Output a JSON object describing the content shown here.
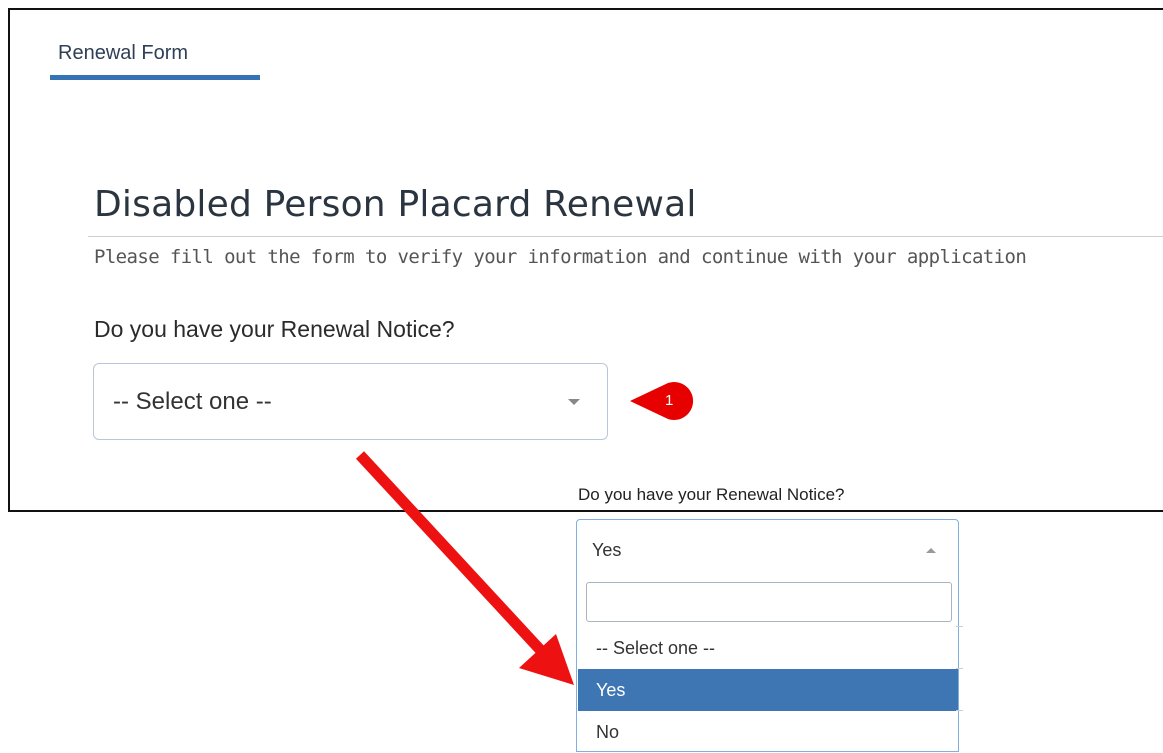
{
  "tab": {
    "label": "Renewal Form"
  },
  "page": {
    "heading": "Disabled Person Placard Renewal",
    "subtitle": "Please fill out the form to verify your information and continue with your application"
  },
  "question": {
    "label": "Do you have your Renewal Notice?",
    "select_value": "-- Select one --"
  },
  "callout": {
    "number": "1"
  },
  "dropdown": {
    "label": "Do you have your Renewal Notice?",
    "current_value": "Yes",
    "search_value": "",
    "options": [
      "-- Select one --",
      "Yes",
      "No"
    ],
    "selected_option": "Yes"
  },
  "colors": {
    "accent": "#3573b5",
    "selected_bg": "#3e76b4",
    "callout_red": "#e60000",
    "arrow_red": "#ee1111"
  }
}
